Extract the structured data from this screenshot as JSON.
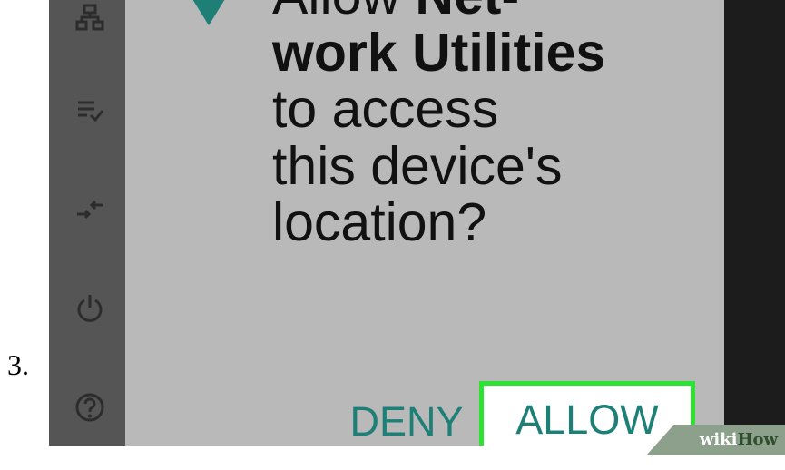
{
  "step": {
    "number": "3."
  },
  "dialog": {
    "prompt_lines": [
      {
        "normal": "Allow ",
        "bold": "Net-"
      },
      {
        "normal": "",
        "bold": "work Utilities"
      },
      {
        "normal": "to access",
        "bold": ""
      },
      {
        "normal": "this device's",
        "bold": ""
      },
      {
        "normal": "location?",
        "bold": ""
      }
    ],
    "deny_label": "DENY",
    "allow_label": "ALLOW",
    "accent_color": "#1e7f77",
    "highlight_color": "#2ee234"
  },
  "sidebar": {
    "icons": [
      "network-icon",
      "list-check-icon",
      "transfer-icon",
      "power-icon",
      "help-icon"
    ]
  },
  "watermark": {
    "wiki": "wiki",
    "how": "How"
  }
}
